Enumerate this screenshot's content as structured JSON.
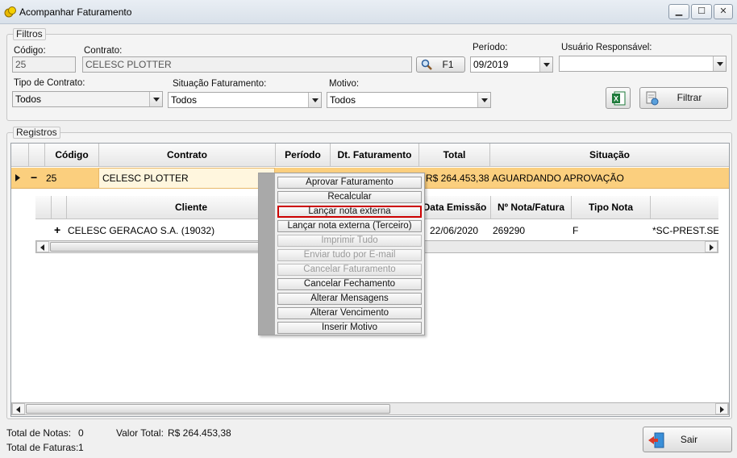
{
  "window": {
    "title": "Acompanhar Faturamento",
    "buttons": {
      "minimize": "▁",
      "maximize": "☐",
      "close": "✕"
    }
  },
  "filters": {
    "title": "Filtros",
    "codigo": {
      "label": "Código:",
      "value": "25"
    },
    "contrato": {
      "label": "Contrato:",
      "value": "CELESC PLOTTER"
    },
    "f1_button": "F1",
    "periodo": {
      "label": "Período:",
      "value": "09/2019"
    },
    "usuario": {
      "label": "Usuário Responsável:",
      "value": ""
    },
    "tipo_contrato": {
      "label": "Tipo de Contrato:",
      "value": "Todos"
    },
    "situacao": {
      "label": "Situação Faturamento:",
      "value": "Todos"
    },
    "motivo": {
      "label": "Motivo:",
      "value": "Todos"
    },
    "filtrar_button": "Filtrar"
  },
  "registros": {
    "title": "Registros",
    "headers": [
      "Código",
      "Contrato",
      "Período",
      "Dt. Faturamento",
      "Total",
      "Situação"
    ],
    "row": {
      "expand": "−",
      "codigo": "25",
      "contrato": "CELESC PLOTTER",
      "total": "R$ 264.453,38",
      "situacao": "AGUARDANDO APROVAÇÃO"
    },
    "sub_headers": [
      "Cliente",
      "Data Emissão",
      "Nº Nota/Fatura",
      "Tipo Nota"
    ],
    "sub_row": {
      "expand": "+",
      "cliente": "CELESC GERACAO S.A. (19032)",
      "data_emissao": "22/06/2020",
      "nota": "269290",
      "tipo": "F",
      "extra": "*SC-PREST.SER"
    }
  },
  "context_menu": {
    "items": [
      {
        "label": "Aprovar Faturamento",
        "enabled": true
      },
      {
        "label": "Recalcular",
        "enabled": true
      },
      {
        "label": "Lançar nota externa",
        "enabled": true,
        "highlighted": true
      },
      {
        "label": "Lançar nota externa (Terceiro)",
        "enabled": true
      },
      {
        "label": "Imprimir Tudo",
        "enabled": false
      },
      {
        "label": "Enviar tudo por E-mail",
        "enabled": false
      },
      {
        "label": "Cancelar Faturamento",
        "enabled": false
      },
      {
        "label": "Cancelar Fechamento",
        "enabled": true
      },
      {
        "label": "Alterar Mensagens",
        "enabled": true
      },
      {
        "label": "Alterar Vencimento",
        "enabled": true
      },
      {
        "label": "Inserir Motivo",
        "enabled": true
      }
    ]
  },
  "footer": {
    "total_notas_label": "Total de Notas:",
    "total_notas": "0",
    "valor_total_label": "Valor Total:",
    "valor_total": "R$ 264.453,38",
    "total_faturas_label": "Total de Faturas:",
    "total_faturas": "1",
    "sair_button": "Sair"
  },
  "colors": {
    "selected_row": "#fbcf7e",
    "highlight_border": "#cc0000",
    "excel_green": "#1d7a3a"
  }
}
